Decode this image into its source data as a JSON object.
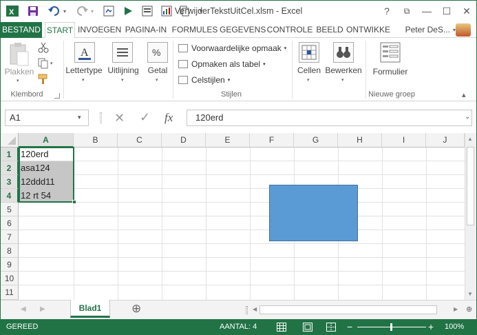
{
  "window": {
    "title": "VerwijderTekstUitCel.xlsm - Excel",
    "controls": {
      "help": "?",
      "restore": "⧉",
      "minimize": "—",
      "maximize": "☐",
      "close": "✕"
    }
  },
  "tabs": {
    "file": "BESTAND",
    "start": "START",
    "insert": "INVOEGEN",
    "page_layout": "PAGINA-IN",
    "formulas": "FORMULES",
    "data": "GEGEVENS",
    "review": "CONTROLE",
    "view": "BEELD",
    "developer": "ONTWIKKE",
    "user": "Peter DeS..."
  },
  "ribbon": {
    "clipboard": {
      "paste": "Plakken",
      "group": "Klembord"
    },
    "font": "Lettertype",
    "alignment": "Uitlijning",
    "number": "Getal",
    "styles": {
      "conditional": "Voorwaardelijke opmaak",
      "format_table": "Opmaken als tabel",
      "cell_styles": "Celstijlen",
      "group": "Stijlen"
    },
    "cells": "Cellen",
    "editing": "Bewerken",
    "form": {
      "label": "Formulier",
      "group": "Nieuwe groep"
    }
  },
  "formula_bar": {
    "name_box": "A1",
    "content": "120erd",
    "fx": "fx"
  },
  "sheet": {
    "columns": [
      "A",
      "B",
      "C",
      "D",
      "E",
      "F",
      "G",
      "H",
      "I",
      "J"
    ],
    "rows": [
      "1",
      "2",
      "3",
      "4",
      "5",
      "6",
      "7",
      "8",
      "9",
      "10",
      "11"
    ],
    "cells": [
      "120erd",
      "asa124",
      "12ddd11",
      "12 rt 54"
    ]
  },
  "sheet_tabs": {
    "active": "Blad1",
    "add": "⊕"
  },
  "status": {
    "ready": "GEREED",
    "count": "AANTAL: 4",
    "zoom": "100%"
  },
  "colors": {
    "accent": "#217346",
    "shape_fill": "#5b9bd5",
    "selection": "#c6c6c6"
  }
}
